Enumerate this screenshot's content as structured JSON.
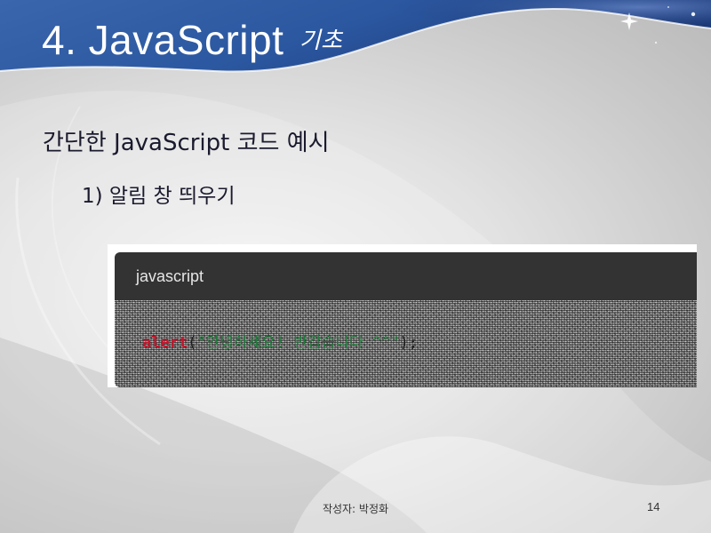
{
  "slide": {
    "title_main": "4. JavaScript",
    "title_suffix": "기초",
    "heading": "간단한 JavaScript 코드 예시",
    "subitem": "1)  알림 창 띄우기"
  },
  "code_block": {
    "language": "javascript",
    "function_name": "alert",
    "open_paren": "(",
    "string_literal": "\"안녕하세요! 반갑습니다 ^^\"",
    "close_paren": ");"
  },
  "footer": {
    "author": "작성자: 박정화",
    "page_number": "14"
  },
  "colors": {
    "banner_blue": "#2e5aa0",
    "banner_dark": "#1b3a78",
    "code_header_bg": "#333333",
    "code_fn": "#c0162c",
    "code_str": "#1f7a3a"
  }
}
